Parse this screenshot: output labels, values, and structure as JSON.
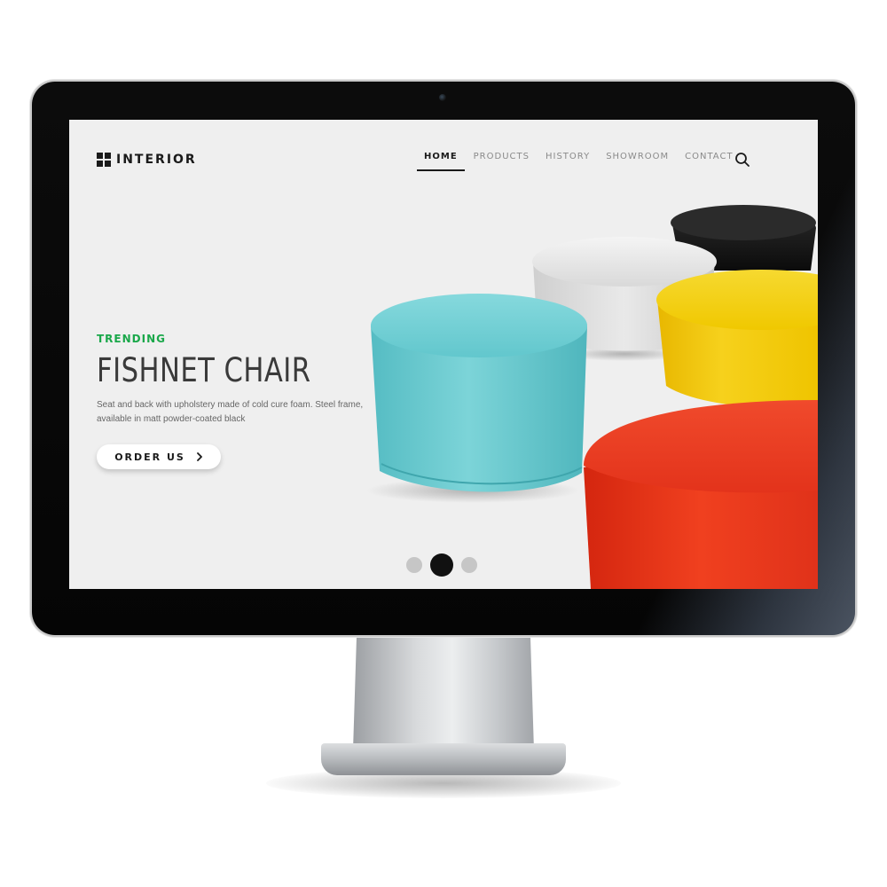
{
  "site": {
    "brand": "INTERIOR",
    "nav": {
      "items": [
        {
          "label": "HOME",
          "active": true
        },
        {
          "label": "PRODUCTS",
          "active": false
        },
        {
          "label": "HISTORY",
          "active": false
        },
        {
          "label": "SHOWROOM",
          "active": false
        },
        {
          "label": "CONTACT",
          "active": false
        }
      ]
    },
    "hero": {
      "eyebrow": "TRENDING",
      "title": "FISHNET CHAIR",
      "description_line1": "Seat and back with upholstery made of cold cure foam. Steel frame,",
      "description_line2": "available in matt powder-coated black",
      "cta_label": "ORDER US"
    },
    "slider": {
      "count": 3,
      "active_index": 1
    },
    "colors": {
      "accent": "#1aa84a",
      "pouf_teal": "#6fcfd4",
      "pouf_red": "#e9331c",
      "pouf_yellow": "#f4cf13",
      "pouf_white": "#e4e4e4",
      "pouf_black": "#151515"
    },
    "icons": {
      "search": "search-icon",
      "chevron": "chevron-right-icon"
    }
  }
}
